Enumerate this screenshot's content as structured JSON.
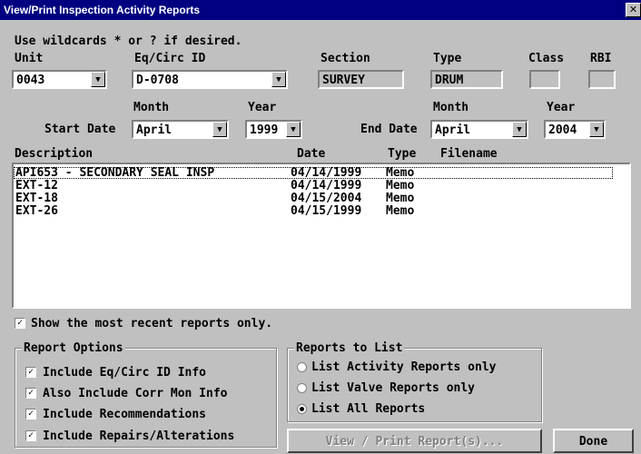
{
  "window": {
    "title": "View/Print Inspection Activity Reports",
    "close_glyph": "✕"
  },
  "hint": "Use wildcards * or ? if desired.",
  "fields": {
    "unit_label": "Unit",
    "unit_value": "0043",
    "eqcirc_label": "Eq/Circ ID",
    "eqcirc_value": "D-0708",
    "section_label": "Section",
    "section_value": "SURVEY",
    "type_label": "Type",
    "type_value": "DRUM",
    "class_label": "Class",
    "class_value": "",
    "rbi_label": "RBI",
    "rbi_value": ""
  },
  "dates": {
    "month_label": "Month",
    "year_label": "Year",
    "start_label": "Start Date",
    "start_month": "April",
    "start_year": "1999",
    "end_label": "End Date",
    "end_month": "April",
    "end_year": "2004"
  },
  "report_list": {
    "columns": [
      "Description",
      "Date",
      "Type",
      "Filename"
    ],
    "rows": [
      {
        "description": "API653 - SECONDARY SEAL INSP",
        "date": "04/14/1999",
        "type": "Memo",
        "filename": ""
      },
      {
        "description": "EXT-12",
        "date": "04/14/1999",
        "type": "Memo",
        "filename": ""
      },
      {
        "description": "EXT-18",
        "date": "04/15/2004",
        "type": "Memo",
        "filename": ""
      },
      {
        "description": "EXT-26",
        "date": "04/15/1999",
        "type": "Memo",
        "filename": ""
      }
    ]
  },
  "show_recent": {
    "label": "Show the most recent reports only.",
    "checked": true
  },
  "report_options": {
    "title": "Report Options",
    "items": [
      {
        "label": "Include Eq/Circ ID Info",
        "checked": true
      },
      {
        "label": "Also Include Corr Mon Info",
        "checked": true
      },
      {
        "label": "Include Recommendations",
        "checked": true
      },
      {
        "label": "Include Repairs/Alterations",
        "checked": true
      }
    ]
  },
  "reports_to_list": {
    "title": "Reports to List",
    "options": [
      {
        "label": "List Activity Reports only",
        "selected": false
      },
      {
        "label": "List Valve Reports only",
        "selected": false
      },
      {
        "label": "List All Reports",
        "selected": true
      }
    ]
  },
  "buttons": {
    "view_print": "View / Print Report(s)...",
    "done": "Done"
  },
  "icons": {
    "dropdown": "dropdown-arrow-icon",
    "check": "checkmark-icon"
  }
}
